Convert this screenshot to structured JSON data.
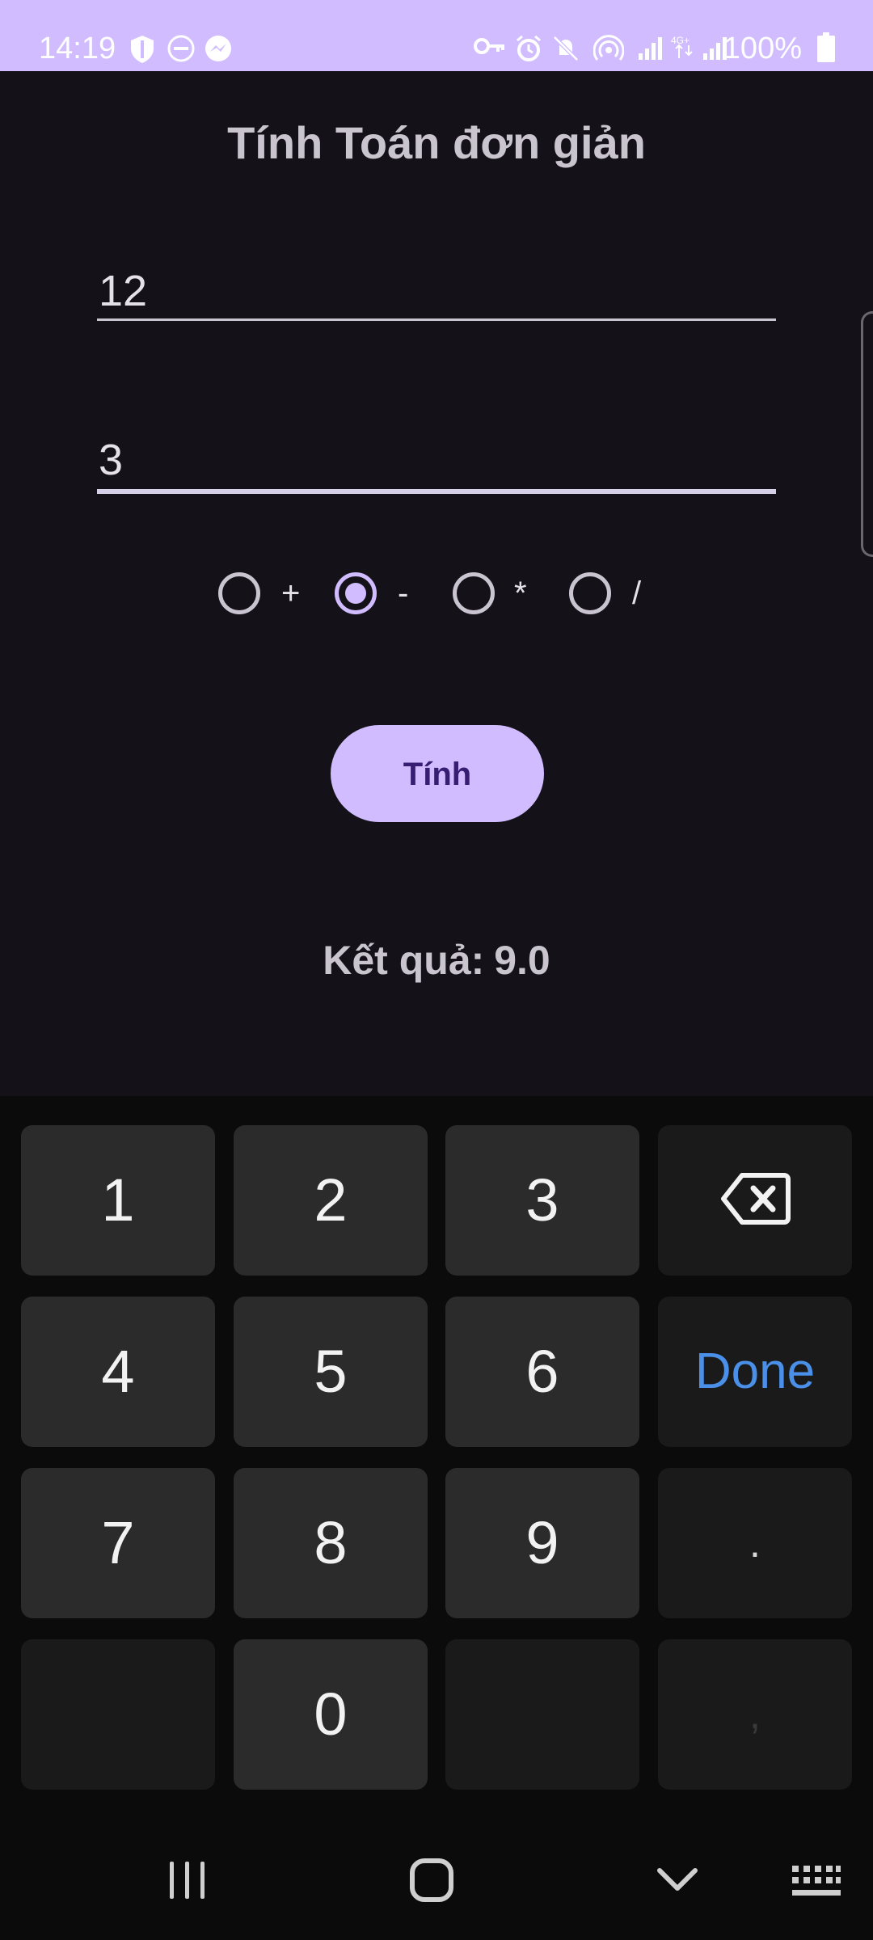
{
  "status_bar": {
    "time": "14:19",
    "battery": "100%",
    "left_icons": [
      "shield-icon",
      "do-not-disturb-icon",
      "messenger-icon"
    ],
    "right_icons": [
      "vpn-key-icon",
      "alarm-icon",
      "mute-icon",
      "hotspot-icon",
      "signal-icon",
      "4g-signal-icon",
      "battery-icon"
    ]
  },
  "app": {
    "title": "Tính Toán đơn giản",
    "input1": {
      "value": "12"
    },
    "input2": {
      "value": "3"
    },
    "operations": [
      {
        "label": "+",
        "checked": false
      },
      {
        "label": "-",
        "checked": true
      },
      {
        "label": "*",
        "checked": false
      },
      {
        "label": "/",
        "checked": false
      }
    ],
    "button_label": "Tính",
    "result_label": "Kết quả:",
    "result_value": "9.0"
  },
  "keyboard": {
    "keys": [
      "1",
      "2",
      "3",
      "4",
      "5",
      "6",
      "7",
      "8",
      "9",
      "0"
    ],
    "done_label": "Done",
    "dot": ".",
    "comma": ",",
    "backspace_icon": "backspace-icon"
  },
  "navigation": {
    "icons": [
      "recents-icon",
      "home-icon",
      "back-icon",
      "keyboard-icon"
    ]
  },
  "colors": {
    "accent": "#d0bcff",
    "background": "#141218",
    "keyboard_bg": "#0b0b0b",
    "done_blue": "#4a90e8"
  }
}
